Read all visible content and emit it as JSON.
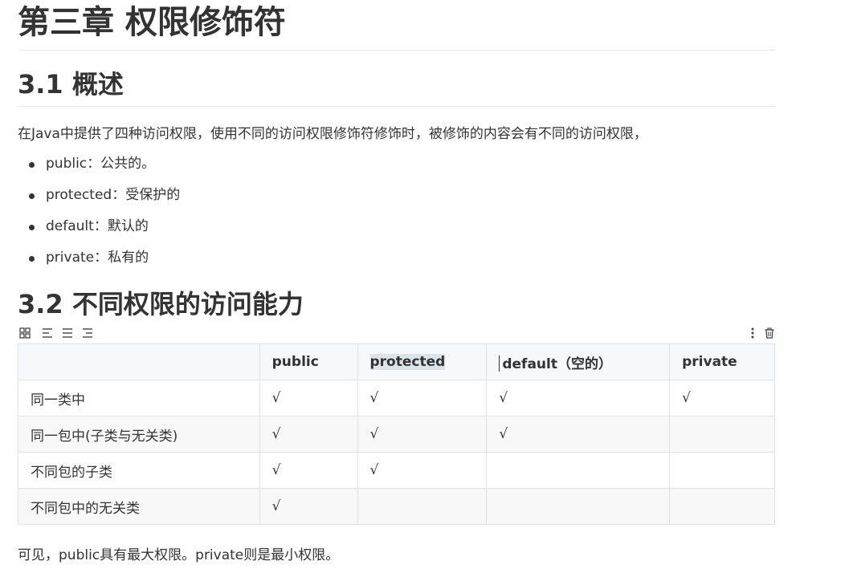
{
  "chapter_title": "第三章 权限修饰符",
  "section_1": {
    "heading": "3.1 概述",
    "intro": "在Java中提供了四种访问权限，使用不同的访问权限修饰符修饰时，被修饰的内容会有不同的访问权限，",
    "items": [
      "public：公共的。",
      "protected：受保护的",
      "default：默认的",
      "private：私有的"
    ]
  },
  "section_2": {
    "heading": "3.2 不同权限的访问能力",
    "toolbar_icons": [
      "grid-icon",
      "align-left-icon",
      "align-center-icon",
      "align-right-icon",
      "more-vertical-icon",
      "delete-icon"
    ],
    "table": {
      "headers": [
        "",
        "public",
        "protected",
        "default（空的）",
        "private"
      ],
      "rows": [
        [
          "同一类中",
          "√",
          "√",
          "√",
          "√"
        ],
        [
          "同一包中(子类与无关类)",
          "√",
          "√",
          "√",
          ""
        ],
        [
          "不同包的子类",
          "√",
          "√",
          "",
          ""
        ],
        [
          "不同包中的无关类",
          "√",
          "",
          "",
          ""
        ]
      ]
    },
    "summary": "可见，public具有最大权限。private则是最小权限。"
  }
}
